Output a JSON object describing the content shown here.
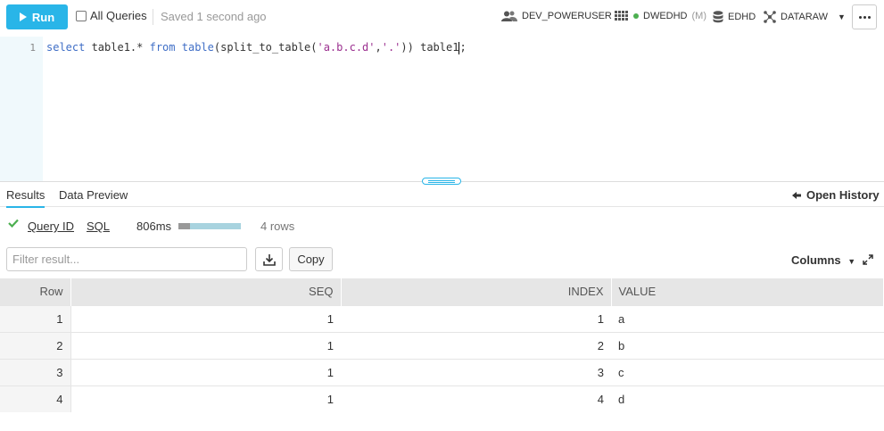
{
  "toolbar": {
    "run_label": "Run",
    "all_queries_label": "All Queries",
    "saved_status": "Saved 1 second ago",
    "role": "DEV_POWERUSER",
    "warehouse": "DWEDHD",
    "warehouse_size": "(M)",
    "database": "EDHD",
    "schema": "DATARAW",
    "accent_color": "#29b5e8"
  },
  "editor": {
    "line_number": "1",
    "code": {
      "kw_select": "select",
      "t1": " table1.* ",
      "kw_from": "from",
      "t2": " ",
      "kw_table": "table",
      "t3": "(split_to_table(",
      "str1": "'a.b.c.d'",
      "t4": ",",
      "str2": "'.'",
      "t5": ")) table1",
      "t6": ";"
    }
  },
  "results": {
    "tabs": [
      "Results",
      "Data Preview"
    ],
    "open_history_label": "Open History",
    "query_id_label": "Query ID",
    "sql_label": "SQL",
    "duration": "806ms",
    "duration_progress": 0.18,
    "rows_label": "4 rows",
    "filter_placeholder": "Filter result...",
    "copy_label": "Copy",
    "columns_label": "Columns"
  },
  "table": {
    "headers": [
      "Row",
      "SEQ",
      "INDEX",
      "VALUE"
    ],
    "rows": [
      [
        "1",
        "1",
        "1",
        "a"
      ],
      [
        "2",
        "1",
        "2",
        "b"
      ],
      [
        "3",
        "1",
        "3",
        "c"
      ],
      [
        "4",
        "1",
        "4",
        "d"
      ]
    ]
  }
}
